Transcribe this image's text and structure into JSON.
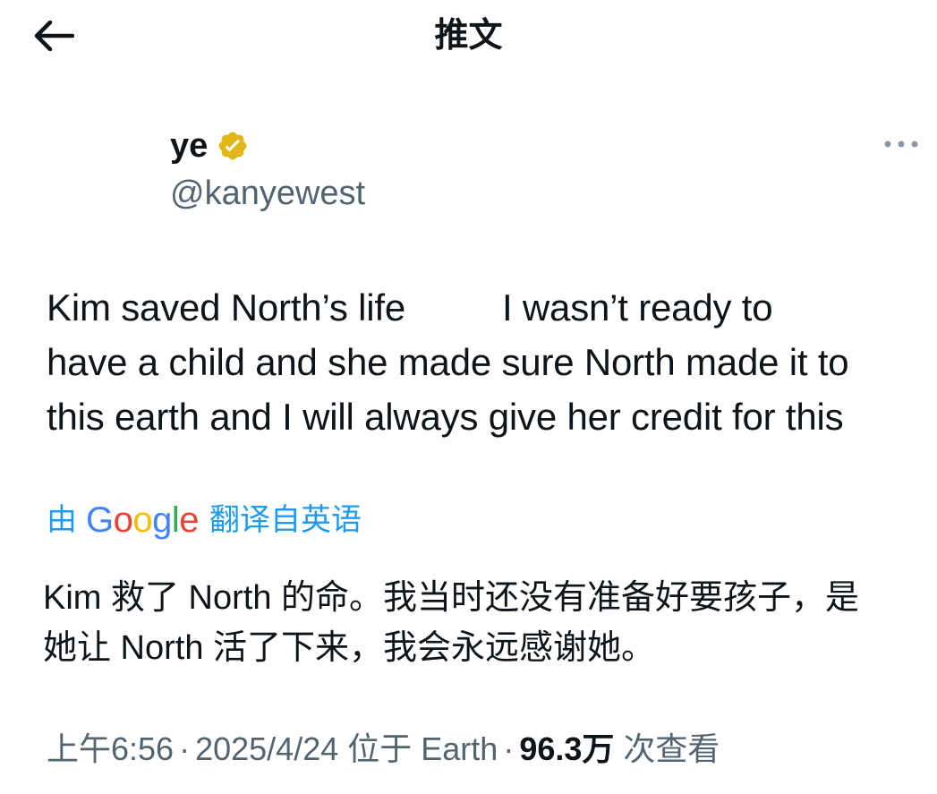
{
  "header": {
    "title": "推文",
    "back_icon": "arrow-left-icon"
  },
  "author": {
    "display_name": "ye",
    "handle": "@kanyewest",
    "badge_icon": "verified-badge-icon",
    "badge_color": "#e2b719"
  },
  "more_icon": "more-horizontal-icon",
  "tweet": {
    "lines": [
      {
        "a": "Kim saved North’s life",
        "b": "I wasn’t ready to"
      },
      "have a child and she made sure North made it to",
      "this earth and I will always give her credit for this"
    ]
  },
  "translation": {
    "by_label": "由",
    "provider": "Google",
    "from_label": "翻译自英语",
    "lines": [
      "Kim 救了 North 的命。我当时还没有准备好要孩子，是",
      "她让 North 活了下来，我会永远感谢她。"
    ]
  },
  "meta": {
    "time": "上午6:56",
    "date": "2025/4/24",
    "location": "位于 Earth",
    "views_count": "96.3万",
    "views_label": "次查看",
    "separator": "·"
  },
  "colors": {
    "link": "#1d9bf0",
    "secondary_text": "#536471",
    "primary_text": "#0f1419",
    "google_blue": "#4285f4",
    "google_red": "#ea4335",
    "google_yellow": "#fbbc05",
    "google_green": "#34a853"
  }
}
